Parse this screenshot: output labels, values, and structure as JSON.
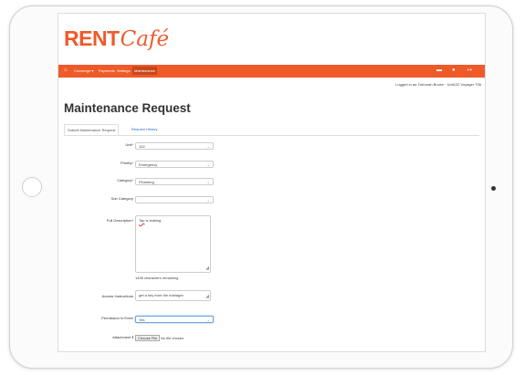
{
  "brand": {
    "logo_rent": "RENT",
    "logo_cafe": "Café"
  },
  "nav": {
    "home_icon": "home-icon",
    "items": [
      "Concierge ▾",
      "Payments",
      "Settings",
      "Maintenance"
    ],
    "right_icons": [
      "message-icon",
      "user-icon",
      "logout-icon"
    ]
  },
  "status": {
    "logged_in": "Logged in as: Deborah Brown · Unit102 Voyager 706"
  },
  "page": {
    "title": "Maintenance Request"
  },
  "tabs": [
    "Submit Maintenance Request",
    "Request History"
  ],
  "form": {
    "unit": {
      "label": "Unit*",
      "value": "102"
    },
    "priority": {
      "label": "Priority*",
      "value": "Emergency"
    },
    "category": {
      "label": "Category*",
      "value": "Plumbing"
    },
    "subcategory": {
      "label": "Sub Category",
      "value": ""
    },
    "description": {
      "label": "Full Description*",
      "word": "Tap",
      "rest": " is leaking",
      "remaining": "1495 characters remaining"
    },
    "access": {
      "label": "Access Instructions",
      "value": "get a key from the manager"
    },
    "permission": {
      "label": "Permission to Enter",
      "value": "Yes"
    },
    "attachment": {
      "label": "Attachment",
      "info_icon": "info-icon",
      "button": "Choose File",
      "no_file": "No file chosen"
    }
  }
}
